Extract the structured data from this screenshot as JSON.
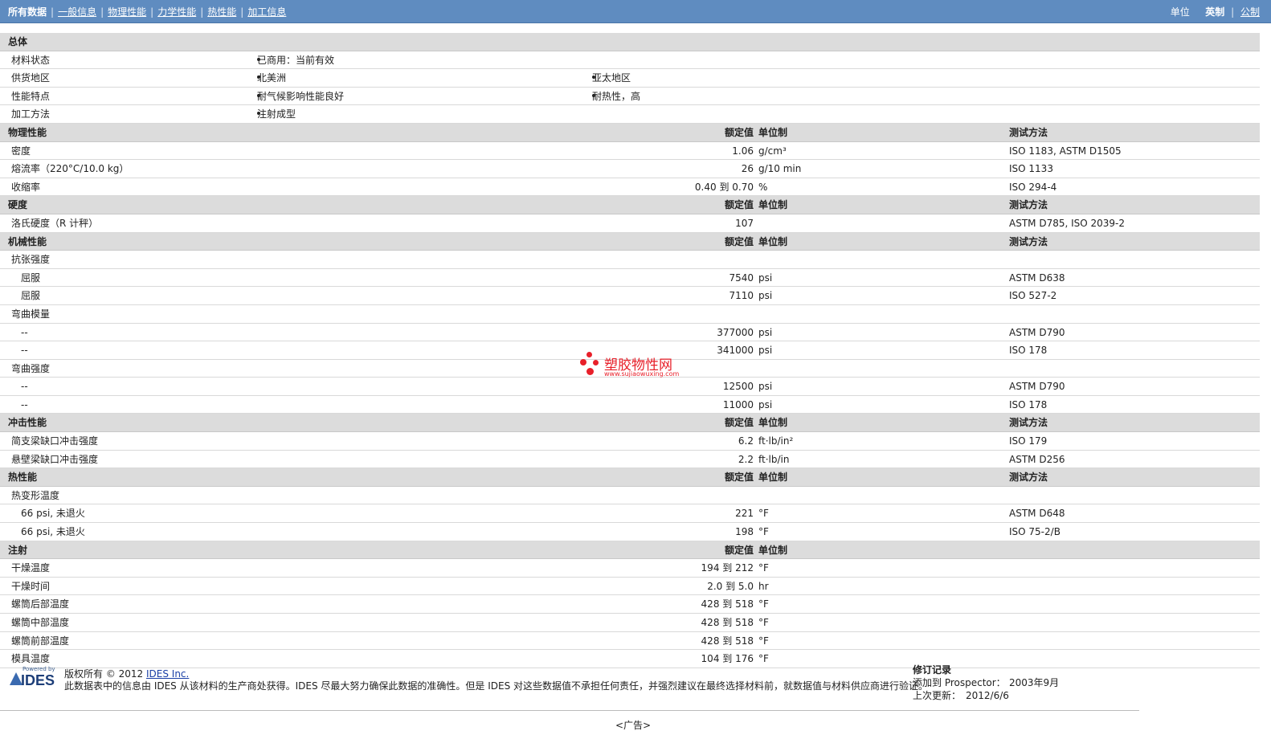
{
  "nav": {
    "tabs": [
      "所有数据",
      "一般信息",
      "物理性能",
      "力学性能",
      "热性能",
      "加工信息"
    ],
    "units_label": "单位",
    "unit_current": "英制",
    "unit_other": "公制"
  },
  "general": {
    "title": "总体",
    "rows": [
      {
        "name": "材料状态",
        "b1": "已商用：当前有效",
        "b2": ""
      },
      {
        "name": "供货地区",
        "b1": "北美洲",
        "b2": "亚太地区"
      },
      {
        "name": "性能特点",
        "b1": "耐气候影响性能良好",
        "b2": "耐热性，高"
      },
      {
        "name": "加工方法",
        "b1": "注射成型",
        "b2": ""
      }
    ]
  },
  "headers": {
    "value": "额定值",
    "unit": "单位制",
    "test": "测试方法"
  },
  "sections": [
    {
      "title": "物理性能",
      "show_test": true,
      "rows": [
        {
          "name": "密度",
          "value": "1.06",
          "unit": "g/cm³",
          "test": "ISO 1183, ASTM D1505"
        },
        {
          "name": "熔流率（220°C/10.0 kg）",
          "value": "26",
          "unit": "g/10 min",
          "test": "ISO 1133"
        },
        {
          "name": "收缩率",
          "value": "0.40 到  0.70",
          "unit": "%",
          "test": "ISO 294-4"
        }
      ]
    },
    {
      "title": "硬度",
      "show_test": true,
      "rows": [
        {
          "name": "洛氏硬度（R 计秤）",
          "value": "107",
          "unit": "",
          "test": "ASTM D785, ISO 2039-2"
        }
      ]
    },
    {
      "title": "机械性能",
      "show_test": true,
      "rows": [
        {
          "name": "抗张强度",
          "value": "",
          "unit": "",
          "test": ""
        },
        {
          "name": "屈服",
          "sub": true,
          "value": "7540",
          "unit": "psi",
          "test": "ASTM D638"
        },
        {
          "name": "屈服",
          "sub": true,
          "value": "7110",
          "unit": "psi",
          "test": "ISO 527-2"
        },
        {
          "name": "弯曲模量",
          "value": "",
          "unit": "",
          "test": ""
        },
        {
          "name": "--",
          "sub": true,
          "value": "377000",
          "unit": "psi",
          "test": "ASTM D790"
        },
        {
          "name": "--",
          "sub": true,
          "value": "341000",
          "unit": "psi",
          "test": "ISO 178"
        },
        {
          "name": "弯曲强度",
          "value": "",
          "unit": "",
          "test": ""
        },
        {
          "name": "--",
          "sub": true,
          "value": "12500",
          "unit": "psi",
          "test": "ASTM D790"
        },
        {
          "name": "--",
          "sub": true,
          "value": "11000",
          "unit": "psi",
          "test": "ISO 178"
        }
      ]
    },
    {
      "title": "冲击性能",
      "show_test": true,
      "rows": [
        {
          "name": "简支梁缺口冲击强度",
          "value": "6.2",
          "unit": "ft·lb/in²",
          "test": "ISO 179"
        },
        {
          "name": "悬壁梁缺口冲击强度",
          "value": "2.2",
          "unit": "ft·lb/in",
          "test": "ASTM D256"
        }
      ]
    },
    {
      "title": "热性能",
      "show_test": true,
      "rows": [
        {
          "name": "热变形温度",
          "value": "",
          "unit": "",
          "test": ""
        },
        {
          "name": "66 psi, 未退火",
          "sub": true,
          "value": "221",
          "unit": "°F",
          "test": "ASTM D648"
        },
        {
          "name": "66 psi, 未退火",
          "sub": true,
          "value": "198",
          "unit": "°F",
          "test": "ISO 75-2/B"
        }
      ]
    },
    {
      "title": "注射",
      "show_test": false,
      "rows": [
        {
          "name": "干燥温度",
          "value": "194 到  212",
          "unit": "°F",
          "test": ""
        },
        {
          "name": "干燥时间",
          "value": "2.0 到  5.0",
          "unit": "hr",
          "test": ""
        },
        {
          "name": "螺筒后部温度",
          "value": "428 到  518",
          "unit": "°F",
          "test": ""
        },
        {
          "name": "螺筒中部温度",
          "value": "428 到  518",
          "unit": "°F",
          "test": ""
        },
        {
          "name": "螺筒前部温度",
          "value": "428 到  518",
          "unit": "°F",
          "test": ""
        },
        {
          "name": "模具温度",
          "value": "104 到  176",
          "unit": "°F",
          "test": ""
        }
      ]
    }
  ],
  "footer": {
    "logo_powered": "Powered by",
    "logo_text": "IDES",
    "copyright": "版权所有 © 2012 ",
    "company_link": "IDES Inc.",
    "disclaimer": "此数据表中的信息由 IDES 从该材料的生产商处获得。IDES 尽最大努力确保此数据的准确性。但是 IDES 对这些数据值不承担任何责任，并强烈建议在最终选择材料前，就数据值与材料供应商进行验证。",
    "revision_title": "修订记录",
    "added_label": "添加到 Prospector：",
    "added_value": "2003年9月",
    "updated_label": "上次更新：",
    "updated_value": "2012/6/6",
    "ad": "<广告>"
  },
  "watermark": {
    "cn": "塑胶物性网",
    "en": "www.sujiaowuxing.com"
  }
}
